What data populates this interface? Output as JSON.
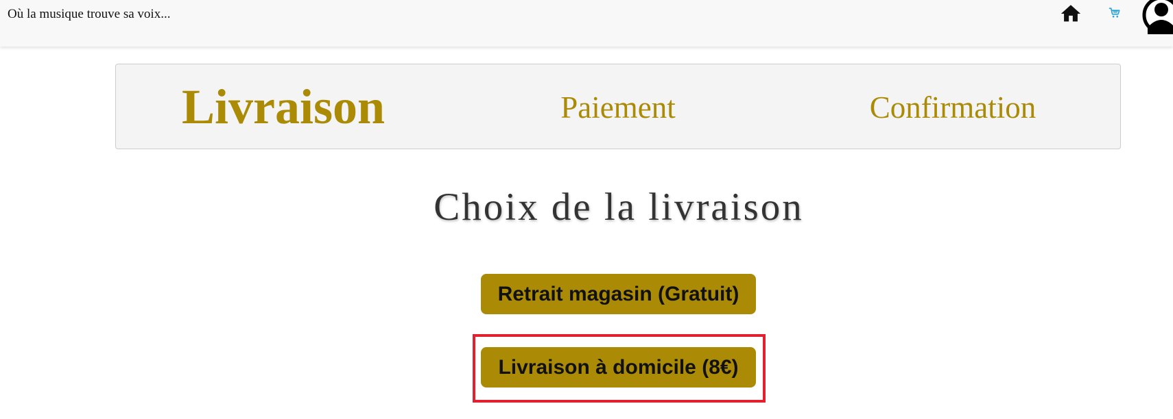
{
  "header": {
    "tagline": "Où la musique trouve sa voix...",
    "icons": {
      "home": "home-icon",
      "cart": "cart-icon",
      "account": "user-avatar-icon"
    },
    "cart_icon_color": "#29a3d8"
  },
  "stepper": {
    "steps": [
      {
        "label": "Livraison",
        "active": true
      },
      {
        "label": "Paiement",
        "active": false
      },
      {
        "label": "Confirmation",
        "active": false
      }
    ],
    "accent_color": "#ab8a06",
    "background_color": "#f4f4f4"
  },
  "delivery": {
    "title": "Choix de la livraison",
    "options": [
      {
        "label": "Retrait magasin (Gratuit)"
      },
      {
        "label": "Livraison à domicile (8€)",
        "highlighted": true
      }
    ],
    "button_color": "#ab8a06",
    "highlight_color": "#e3202e"
  }
}
